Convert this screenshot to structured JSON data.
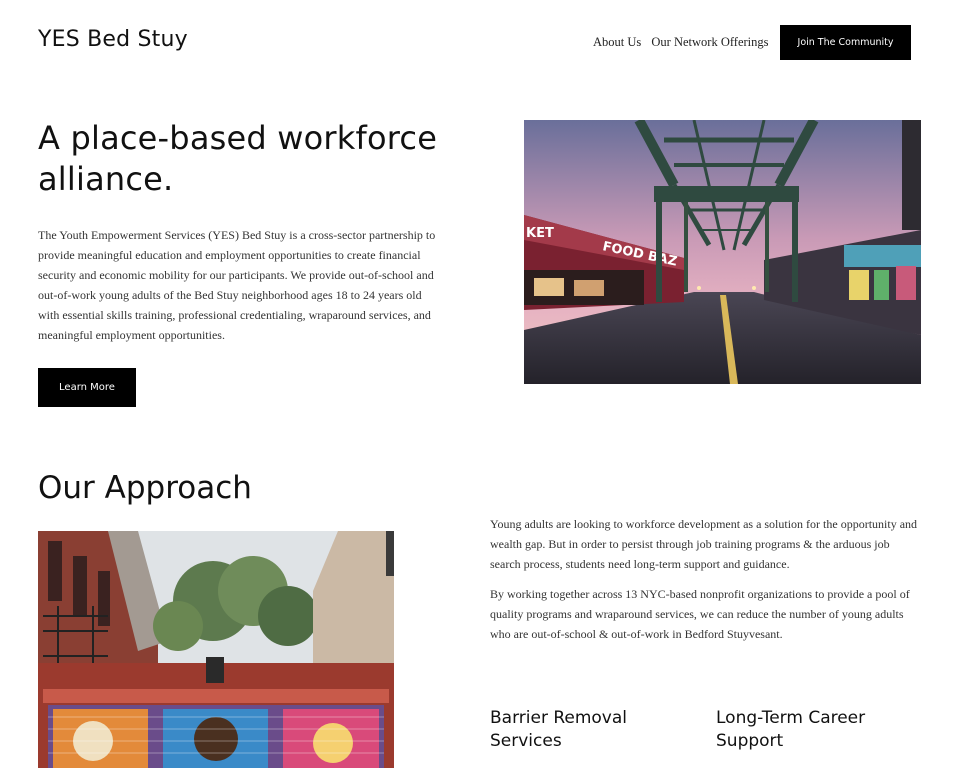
{
  "header": {
    "site_title": "YES Bed Stuy",
    "nav": [
      "About Us",
      "Our Network Offerings"
    ],
    "cta_label": "Join The Community"
  },
  "hero": {
    "heading": "A place-based workforce alliance.",
    "body": "The Youth Empowerment Services (YES) Bed Stuy is a cross-sector partnership to provide meaningful education and employment opportunities to create financial security and economic mobility for our participants. We provide out-of-school and out-of-work young adults of the Bed Stuy neighborhood ages 18 to 24 years old with essential skills training, professional credentialing, wraparound services, and meaningful employment opportunities.",
    "button_label": "Learn More",
    "image": {
      "storefront_signs": [
        "KET",
        "FOOD BAZ"
      ]
    }
  },
  "approach": {
    "heading": "Our Approach",
    "paragraphs": [
      "Young adults are looking to workforce development as a solution for the opportunity and wealth gap. But in order to persist through job training programs & the arduous job search process, students need long-term support and guidance.",
      "By working together across 13 NYC-based nonprofit organizations to provide a pool of quality programs and wraparound services, we can reduce the number of young adults who are out-of-school & out-of-work in Bedford Stuyvesant."
    ],
    "features": [
      {
        "title": "Barrier Removal Services"
      },
      {
        "title": "Long-Term Career Support"
      }
    ]
  },
  "colors": {
    "button_bg": "#000000",
    "button_text": "#ffffff",
    "text": "#111111",
    "body_text": "#333333"
  }
}
